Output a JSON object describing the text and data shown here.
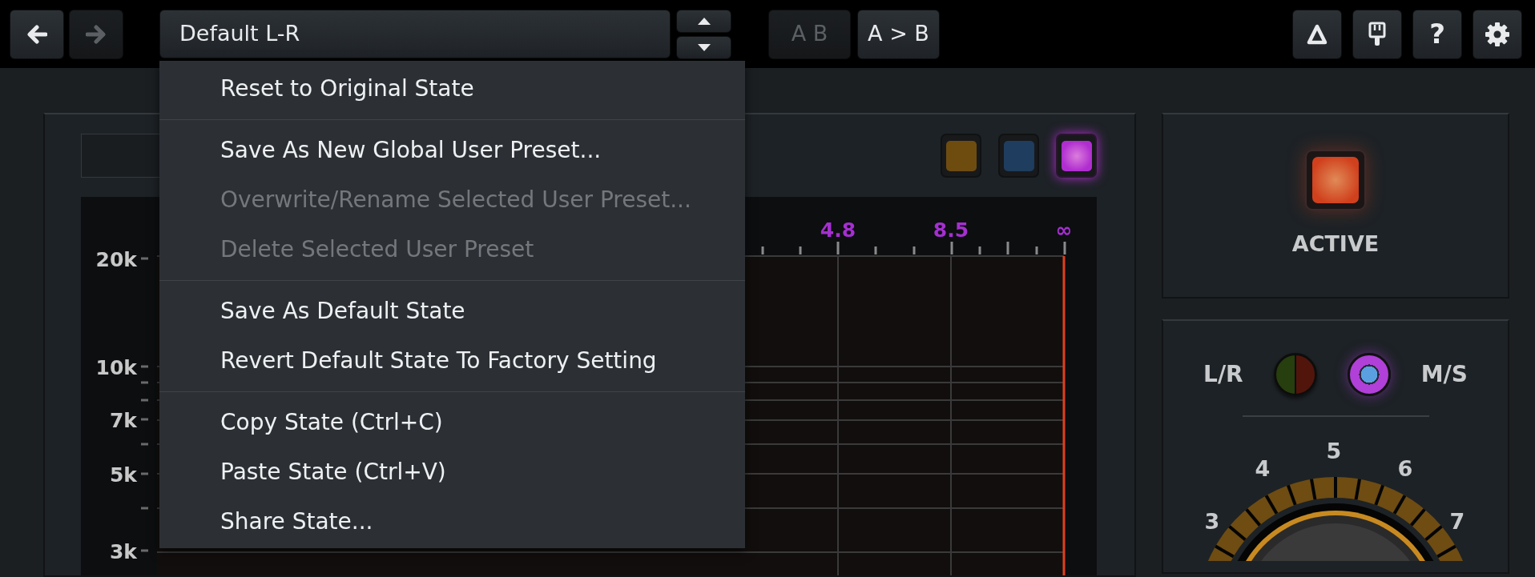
{
  "toolbar": {
    "back": {
      "disabled": false
    },
    "forward": {
      "disabled": true
    },
    "preset": {
      "value": "Default L-R"
    },
    "ab_buttons": [
      {
        "label": "A B",
        "disabled": true
      },
      {
        "label": "A > B",
        "disabled": false
      }
    ],
    "help": {
      "label": "?"
    }
  },
  "menu": {
    "sections": [
      [
        {
          "label": "Reset to Original State",
          "disabled": false
        }
      ],
      [
        {
          "label": "Save As New Global User Preset...",
          "disabled": false
        },
        {
          "label": "Overwrite/Rename Selected User Preset...",
          "disabled": true
        },
        {
          "label": "Delete Selected User Preset",
          "disabled": true
        }
      ],
      [
        {
          "label": "Save As Default State",
          "disabled": false
        },
        {
          "label": "Revert Default State To Factory Setting",
          "disabled": false
        }
      ],
      [
        {
          "label": "Copy State (Ctrl+C)",
          "disabled": false
        },
        {
          "label": "Paste State (Ctrl+V)",
          "disabled": false
        },
        {
          "label": "Share State...",
          "disabled": false
        }
      ]
    ]
  },
  "color_buttons": [
    {
      "color": "#6e4c10",
      "selected": false
    },
    {
      "color": "#1f3d5e",
      "selected": false
    },
    {
      "color": "#b02ed0",
      "selected": true
    }
  ],
  "graph": {
    "x_labels": [
      "4.8",
      "8.5",
      "∞"
    ],
    "y_labels": [
      "20k",
      "10k",
      "7k",
      "5k",
      "3k"
    ]
  },
  "active": {
    "label": "ACTIVE",
    "on": true
  },
  "mode": [
    {
      "kind": "stereo",
      "label": "L/R",
      "selected": false
    },
    {
      "kind": "midside",
      "label": "M/S",
      "selected": true
    }
  ],
  "knob": {
    "labels": [
      "3",
      "4",
      "5",
      "6",
      "7"
    ]
  }
}
